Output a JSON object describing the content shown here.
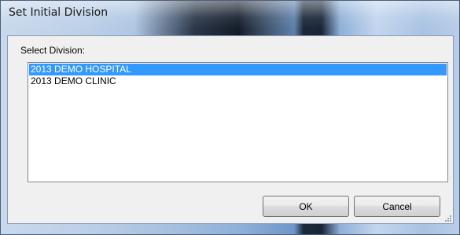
{
  "window": {
    "title": "Set Initial Division"
  },
  "form": {
    "select_label": "Select Division:"
  },
  "divisions": {
    "items": [
      {
        "label": "2013 DEMO HOSPITAL",
        "selected": true
      },
      {
        "label": "2013 DEMO CLINIC",
        "selected": false
      }
    ]
  },
  "buttons": {
    "ok_label": "OK",
    "cancel_label": "Cancel"
  },
  "colors": {
    "selection": "#3399ff",
    "selection_text": "#ffffff",
    "client_background": "#f0f0f0"
  }
}
